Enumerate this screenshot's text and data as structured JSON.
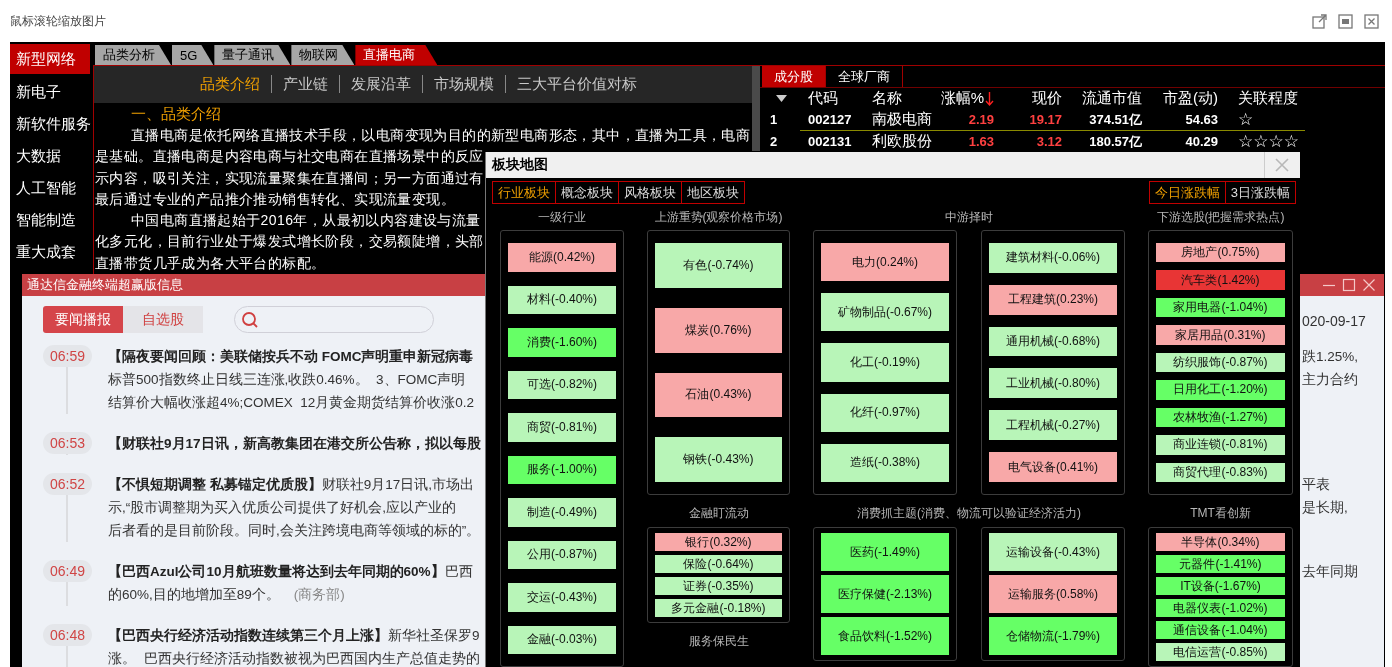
{
  "viewer": {
    "title": "鼠标滚轮缩放图片"
  },
  "sidebar": {
    "items": [
      {
        "label": "新型网络",
        "selected": true
      },
      {
        "label": "新电子",
        "selected": false
      },
      {
        "label": "新软件服务",
        "selected": false
      },
      {
        "label": "大数据",
        "selected": false
      },
      {
        "label": "人工智能",
        "selected": false
      },
      {
        "label": "智能制造",
        "selected": false
      },
      {
        "label": "重大成套",
        "selected": false
      }
    ]
  },
  "tabs": [
    {
      "label": "品类分析",
      "selected": false
    },
    {
      "label": "5G",
      "selected": false
    },
    {
      "label": "量子通讯",
      "selected": false
    },
    {
      "label": "物联网",
      "selected": false
    },
    {
      "label": "直播电商",
      "selected": true
    }
  ],
  "article": {
    "nav": [
      {
        "label": "品类介绍",
        "selected": true
      },
      {
        "label": "产业链",
        "selected": false
      },
      {
        "label": "发展沿革",
        "selected": false
      },
      {
        "label": "市场规模",
        "selected": false
      },
      {
        "label": "三大平台价值对标",
        "selected": false
      }
    ],
    "heading": "一、品类介绍",
    "paragraphs": [
      {
        "lines": [
          "直播电商是依托网络直播技术手段，以电商变现为目的的新型电商形态，其中，直播为工具，电商",
          "是基础。直播电商是内容电商与社交电商在直播场景中的反应",
          "示内容，吸引关注，实现流量聚集在直播间；另一方面通过有",
          "最后通过专业的产品推介推动销售转化、实现流量变现。"
        ]
      },
      {
        "lines": [
          "中国电商直播起始于2016年，从最初以内容建设与流量",
          "化多元化，目前行业处于爆发式增长阶段，交易额陡增，头部",
          "直播带货几乎成为各大平台的标配。"
        ]
      }
    ]
  },
  "stocks": {
    "tabs": [
      {
        "label": "成分股",
        "selected": true
      },
      {
        "label": "全球厂商",
        "selected": false
      }
    ],
    "columns": [
      {
        "label": "代码",
        "sorted": false
      },
      {
        "label": "名称",
        "sorted": false
      },
      {
        "label": "涨幅%",
        "sorted": true
      },
      {
        "label": "现价",
        "sorted": false
      },
      {
        "label": "流通市值",
        "sorted": false
      },
      {
        "label": "市盈(动)",
        "sorted": false
      },
      {
        "label": "关联程度",
        "sorted": false
      }
    ],
    "rows": [
      {
        "index": "1",
        "code": "002127",
        "name": "南极电商",
        "change": "2.19",
        "price": "19.17",
        "float_cap": "374.51亿",
        "pe": "54.63",
        "relevance": "☆",
        "rising": true
      },
      {
        "index": "2",
        "code": "002131",
        "name": "利欧股份",
        "change": "1.63",
        "price": "3.12",
        "float_cap": "180.57亿",
        "pe": "40.29",
        "relevance": "☆☆☆☆",
        "rising": true
      }
    ]
  },
  "news_window": {
    "title": "通达信金融终端超赢版信息",
    "tabs": [
      {
        "label": "要闻播报",
        "selected": true
      },
      {
        "label": "自选股",
        "selected": false
      }
    ],
    "date": "020-09-17",
    "items": [
      {
        "time": "06:59",
        "lines": [
          {
            "text": "**【隔夜要闻回顾：美联储按兵不动 FOMC声明重申新冠病毒**",
            "tail": "跌1.25%,"
          },
          {
            "text": "标普500指数终止日线三连涨,收跌0.46%。  3、FOMC声明",
            "tail": "主力合约"
          },
          {
            "text": "结算价大幅收涨超4%;COMEX  12月黄金期货结算价收涨0.2"
          }
        ]
      },
      {
        "time": "06:53",
        "lines": [
          {
            "text": "**【财联社9月17日讯，新高教集团在港交所公告称，拟以每股**"
          }
        ]
      },
      {
        "time": "06:52",
        "lines": [
          {
            "text": "**【不惧短期调整 私募锚定优质股】**财联社9月17日讯,市场出",
            "tail": "平表"
          },
          {
            "text": "示,“股市调整期为买入优质公司提供了好机会,应以产业的",
            "tail": "是长期,"
          },
          {
            "text": "后者看的是目前阶段。同时,会关注跨境电商等领域的标的”。"
          }
        ]
      },
      {
        "time": "06:49",
        "lines": [
          {
            "text": "**【巴西Azul公司10月航班数量将达到去年同期的60%】**巴西",
            "tail": "去年同期"
          },
          {
            "text": "的60%,目的地增加至89个。",
            "source": "(商务部)"
          }
        ]
      },
      {
        "time": "06:48",
        "lines": [
          {
            "text": "**【巴西央行经济活动指数连续第三个月上涨】**新华社圣保罗9"
          },
          {
            "text": "涨。  巴西央行经济活动指数被视为巴西国内生产总值走势的"
          }
        ]
      }
    ]
  },
  "board_map": {
    "title": "板块地图",
    "tabs": [
      {
        "label": "行业板块",
        "selected": true
      },
      {
        "label": "概念板块",
        "selected": false
      },
      {
        "label": "风格板块",
        "selected": false
      },
      {
        "label": "地区板块",
        "selected": false
      }
    ],
    "range_tabs": [
      {
        "label": "今日涨跌幅",
        "selected": true
      },
      {
        "label": "3日涨跌幅",
        "selected": false
      }
    ],
    "groups": [
      {
        "sections": [
          {
            "title": "一级行业",
            "boxes": [
              {
                "tiles": [
                  {
                    "label": "能源(0.42%)",
                    "color": "#f8a8a8"
                  },
                  {
                    "label": "材料(-0.40%)",
                    "color": "#b8f5b8"
                  },
                  {
                    "label": "消费(-1.60%)",
                    "color": "#66ff66"
                  },
                  {
                    "label": "可选(-0.82%)",
                    "color": "#b8f5b8"
                  },
                  {
                    "label": "商贸(-0.81%)",
                    "color": "#b8f5b8"
                  },
                  {
                    "label": "服务(-1.00%)",
                    "color": "#66ff66"
                  },
                  {
                    "label": "制造(-0.49%)",
                    "color": "#b8f5b8"
                  },
                  {
                    "label": "公用(-0.87%)",
                    "color": "#b8f5b8"
                  },
                  {
                    "label": "交运(-0.43%)",
                    "color": "#b8f5b8"
                  },
                  {
                    "label": "金融(-0.03%)",
                    "color": "#b8f5b8"
                  }
                ]
              }
            ]
          }
        ]
      },
      {
        "sections": [
          {
            "title": "上游重势(观察价格市场)",
            "boxes": [
              {
                "tiles": [
                  {
                    "label": "有色(-0.74%)",
                    "color": "#b8f5b8"
                  },
                  {
                    "label": "煤炭(0.76%)",
                    "color": "#f8a8a8"
                  },
                  {
                    "label": "石油(0.43%)",
                    "color": "#f8a8a8"
                  },
                  {
                    "label": "钢铁(-0.43%)",
                    "color": "#b8f5b8"
                  }
                ]
              }
            ]
          },
          {
            "title": "金融盯流动",
            "boxes": [
              {
                "tiles": [
                  {
                    "label": "银行(0.32%)",
                    "color": "#f8a8a8"
                  },
                  {
                    "label": "保险(-0.64%)",
                    "color": "#b8f5b8"
                  },
                  {
                    "label": "证券(-0.35%)",
                    "color": "#b8f5b8"
                  },
                  {
                    "label": "多元金融(-0.18%)",
                    "color": "#b8f5b8"
                  }
                ]
              }
            ]
          },
          {
            "title": "服务保民生"
          }
        ]
      },
      {
        "sections": [
          {
            "title": "中游择时",
            "boxes": [
              {
                "tiles": [
                  {
                    "label": "电力(0.24%)",
                    "color": "#f8a8a8"
                  },
                  {
                    "label": "矿物制品(-0.67%)",
                    "color": "#b8f5b8"
                  },
                  {
                    "label": "化工(-0.19%)",
                    "color": "#b8f5b8"
                  },
                  {
                    "label": "化纤(-0.97%)",
                    "color": "#b8f5b8"
                  },
                  {
                    "label": "造纸(-0.38%)",
                    "color": "#b8f5b8"
                  }
                ]
              },
              {
                "tiles": [
                  {
                    "label": "建筑材料(-0.06%)",
                    "color": "#b8f5b8"
                  },
                  {
                    "label": "工程建筑(0.23%)",
                    "color": "#f8a8a8"
                  },
                  {
                    "label": "通用机械(-0.68%)",
                    "color": "#b8f5b8"
                  },
                  {
                    "label": "工业机械(-0.80%)",
                    "color": "#b8f5b8"
                  },
                  {
                    "label": "工程机械(-0.27%)",
                    "color": "#b8f5b8"
                  },
                  {
                    "label": "电气设备(0.41%)",
                    "color": "#f8a8a8"
                  }
                ]
              }
            ]
          },
          {
            "title": "消费抓主题(消费、物流可以验证经济活力)",
            "boxes": [
              {
                "tiles": [
                  {
                    "label": "医药(-1.49%)",
                    "color": "#66ff66"
                  },
                  {
                    "label": "医疗保健(-2.13%)",
                    "color": "#66ff66"
                  },
                  {
                    "label": "食品饮料(-1.52%)",
                    "color": "#66ff66"
                  }
                ]
              },
              {
                "tiles": [
                  {
                    "label": "运输设备(-0.43%)",
                    "color": "#b8f5b8"
                  },
                  {
                    "label": "运输服务(0.58%)",
                    "color": "#f8a8a8"
                  },
                  {
                    "label": "仓储物流(-1.79%)",
                    "color": "#66ff66"
                  }
                ]
              }
            ]
          }
        ]
      },
      {
        "sections": [
          {
            "title": "下游选股(把握需求热点)",
            "boxes": [
              {
                "tiles": [
                  {
                    "label": "房地产(0.75%)",
                    "color": "#f8a8a8"
                  },
                  {
                    "label": "汽车类(1.42%)",
                    "color": "#e83535"
                  },
                  {
                    "label": "家用电器(-1.04%)",
                    "color": "#66ff66"
                  },
                  {
                    "label": "家居用品(0.31%)",
                    "color": "#f8a8a8"
                  },
                  {
                    "label": "纺织服饰(-0.87%)",
                    "color": "#b8f5b8"
                  },
                  {
                    "label": "日用化工(-1.20%)",
                    "color": "#66ff66"
                  },
                  {
                    "label": "农林牧渔(-1.27%)",
                    "color": "#66ff66"
                  },
                  {
                    "label": "商业连锁(-0.81%)",
                    "color": "#b8f5b8"
                  },
                  {
                    "label": "商贸代理(-0.83%)",
                    "color": "#b8f5b8"
                  }
                ]
              }
            ]
          },
          {
            "title": "TMT看创新",
            "boxes": [
              {
                "tiles": [
                  {
                    "label": "半导体(0.34%)",
                    "color": "#f8a8a8"
                  },
                  {
                    "label": "元器件(-1.41%)",
                    "color": "#66ff66"
                  },
                  {
                    "label": "IT设备(-1.67%)",
                    "color": "#66ff66"
                  },
                  {
                    "label": "电器仪表(-1.02%)",
                    "color": "#66ff66"
                  },
                  {
                    "label": "通信设备(-1.04%)",
                    "color": "#66ff66"
                  },
                  {
                    "label": "电信运营(-0.85%)",
                    "color": "#b8f5b8"
                  }
                ]
              }
            ]
          }
        ]
      }
    ]
  }
}
